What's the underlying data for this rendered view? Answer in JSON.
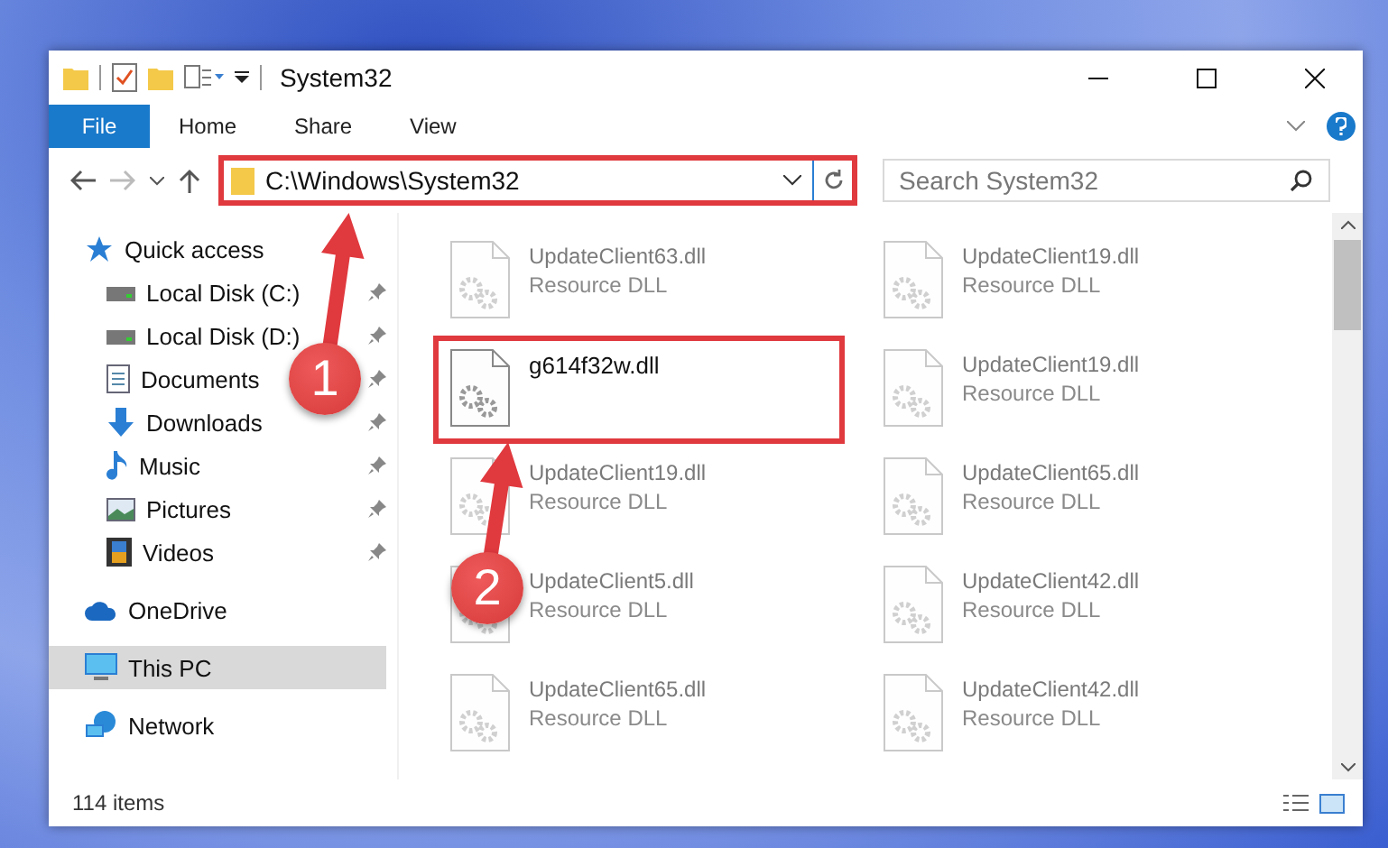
{
  "window": {
    "title": "System32"
  },
  "ribbon": {
    "tabs": [
      {
        "label": "File",
        "kind": "file"
      },
      {
        "label": "Home",
        "kind": "tab"
      },
      {
        "label": "Share",
        "kind": "tab"
      },
      {
        "label": "View",
        "kind": "tab"
      }
    ]
  },
  "address": {
    "path": "C:\\Windows\\System32",
    "highlighted": true
  },
  "search": {
    "placeholder": "Search System32"
  },
  "nav": {
    "items": [
      {
        "label": "Quick access",
        "kind": "star",
        "selected": false,
        "children": [
          {
            "label": "Local Disk (C:)",
            "kind": "drive",
            "pinned": true,
            "selected": false
          },
          {
            "label": "Local Disk (D:)",
            "kind": "drive",
            "pinned": true,
            "selected": false
          },
          {
            "label": "Documents",
            "kind": "document",
            "pinned": true,
            "selected": false
          },
          {
            "label": "Downloads",
            "kind": "download",
            "pinned": true,
            "selected": false
          },
          {
            "label": "Music",
            "kind": "music",
            "pinned": true,
            "selected": false
          },
          {
            "label": "Pictures",
            "kind": "pictures",
            "pinned": true,
            "selected": false
          },
          {
            "label": "Videos",
            "kind": "videos",
            "pinned": true,
            "selected": false
          }
        ]
      },
      {
        "label": "OneDrive",
        "kind": "cloud",
        "selected": false
      },
      {
        "label": "This PC",
        "kind": "computer",
        "selected": true
      },
      {
        "label": "Network",
        "kind": "network",
        "selected": false
      }
    ]
  },
  "files": [
    {
      "name": "UpdateClient63.dll",
      "type": "Resource DLL",
      "dimmed": true,
      "highlighted": false
    },
    {
      "name": "UpdateClient19.dll",
      "type": "Resource DLL",
      "dimmed": true,
      "highlighted": false
    },
    {
      "name": "g614f32w.dll",
      "dimmed": false,
      "highlighted": true
    },
    {
      "name": "UpdateClient19.dll",
      "type": "Resource DLL",
      "dimmed": true,
      "highlighted": false
    },
    {
      "name": "UpdateClient19.dll",
      "type": "Resource DLL",
      "dimmed": true,
      "highlighted": false
    },
    {
      "name": "UpdateClient65.dll",
      "type": "Resource DLL",
      "dimmed": true,
      "highlighted": false
    },
    {
      "name": "UpdateClient5.dll",
      "type": "Resource DLL",
      "dimmed": true,
      "highlighted": false
    },
    {
      "name": "UpdateClient42.dll",
      "type": "Resource DLL",
      "dimmed": true,
      "highlighted": false
    },
    {
      "name": "UpdateClient65.dll",
      "type": "Resource DLL",
      "dimmed": true,
      "highlighted": false
    },
    {
      "name": "UpdateClient42.dll",
      "type": "Resource DLL",
      "dimmed": true,
      "highlighted": false
    }
  ],
  "callouts": [
    {
      "number": "1"
    },
    {
      "number": "2"
    }
  ],
  "status_bar": {
    "count": "114 items"
  }
}
